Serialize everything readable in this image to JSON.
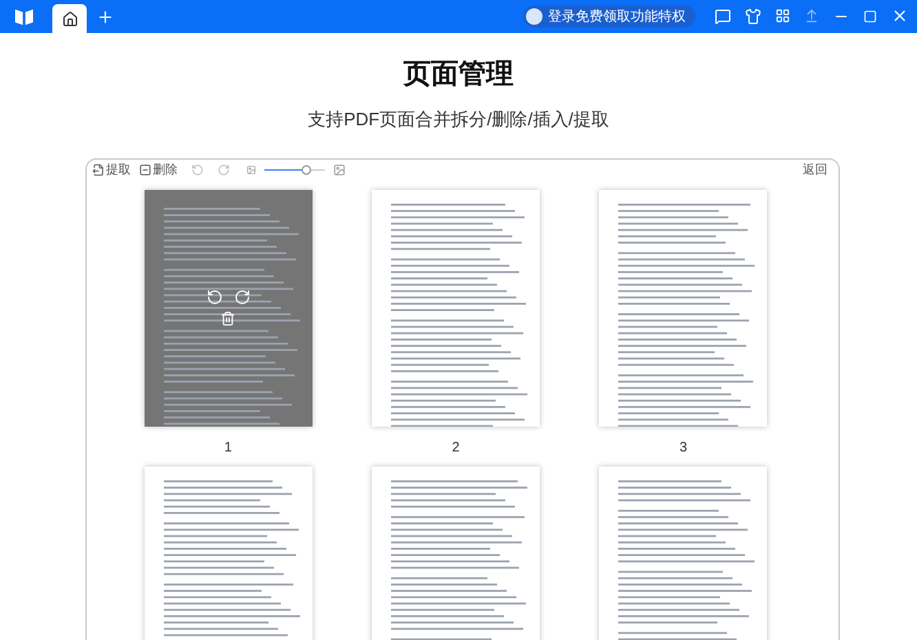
{
  "titlebar": {
    "tabs": [
      {
        "selected": true
      }
    ],
    "login": "登录免费领取功能特权"
  },
  "heading": "页面管理",
  "subheading": "支持PDF页面合并拆分/删除/插入/提取",
  "toolbar": {
    "extract": "提取",
    "delete": "删除",
    "zoom": {
      "level": 0.7
    },
    "back": "返回"
  },
  "pages": [
    {
      "label": "1",
      "selected": true
    },
    {
      "label": "2",
      "selected": false
    },
    {
      "label": "3",
      "selected": false
    },
    {
      "selected": false
    },
    {
      "selected": false
    },
    {
      "selected": false
    }
  ]
}
